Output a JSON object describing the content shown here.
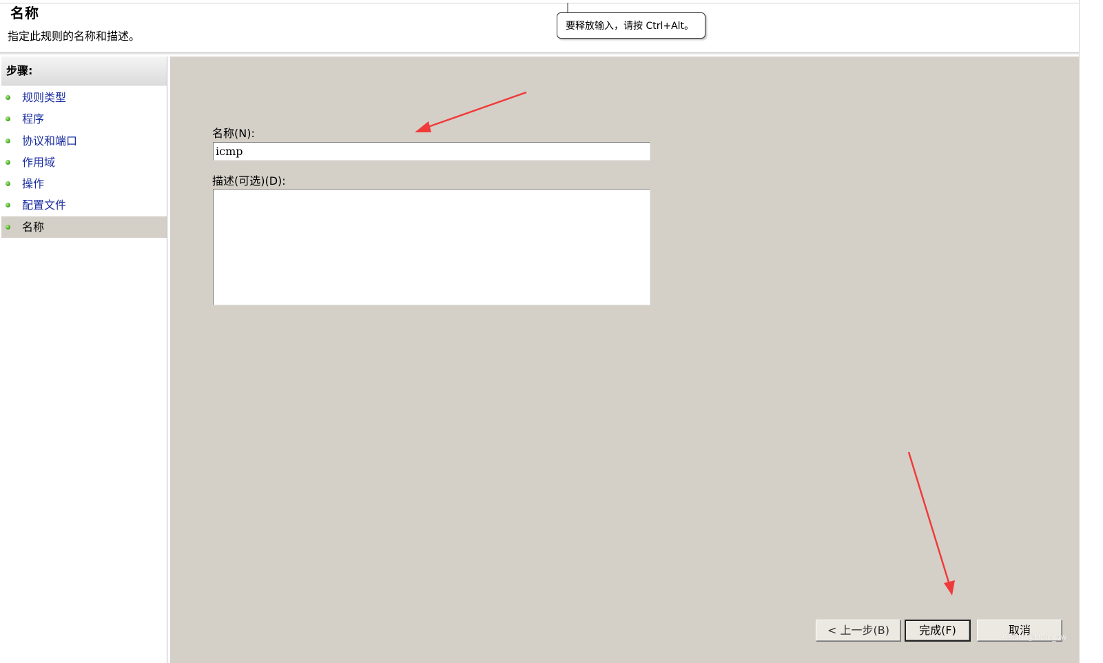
{
  "header": {
    "title": "名称",
    "subtitle": "指定此规则的名称和描述。"
  },
  "tooltip": {
    "text": "要释放输入，请按 Ctrl+Alt。"
  },
  "sidebar": {
    "heading": "步骤:",
    "items": [
      {
        "label": "规则类型"
      },
      {
        "label": "程序"
      },
      {
        "label": "协议和端口"
      },
      {
        "label": "作用域"
      },
      {
        "label": "操作"
      },
      {
        "label": "配置文件"
      },
      {
        "label": "名称",
        "active": true
      }
    ]
  },
  "form": {
    "name_label": "名称(N):",
    "name_value": "icmp",
    "description_label": "描述(可选)(D):",
    "description_value": ""
  },
  "buttons": {
    "back": "< 上一步(B)",
    "finish": "完成(F)",
    "cancel": "取消"
  },
  "watermark": "CSDN @Main_aw",
  "colors": {
    "panel_bg": "#d4d0c8",
    "link_blue": "#1a2da0",
    "arrow_red": "#f03a3a",
    "step_dot": "#3a9a1a"
  }
}
